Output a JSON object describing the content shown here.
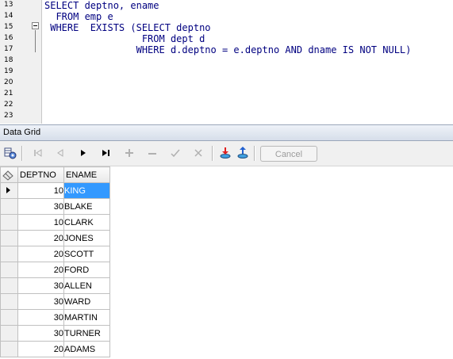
{
  "editor": {
    "lines": [
      {
        "num": "13",
        "text": "SELECT deptno, ename"
      },
      {
        "num": "14",
        "text": "  FROM emp e"
      },
      {
        "num": "15",
        "text": " WHERE  EXISTS (SELECT deptno"
      },
      {
        "num": "16",
        "text": "                 FROM dept d"
      },
      {
        "num": "17",
        "text": "                WHERE d.deptno = e.deptno AND dname IS NOT NULL)"
      },
      {
        "num": "18",
        "text": ""
      },
      {
        "num": "19",
        "text": ""
      },
      {
        "num": "20",
        "text": ""
      },
      {
        "num": "21",
        "text": ""
      },
      {
        "num": "22",
        "text": ""
      },
      {
        "num": "23",
        "text": ""
      }
    ]
  },
  "data_grid": {
    "title": "Data Grid",
    "toolbar": {
      "icons": [
        "grid-options-icon",
        "first-record-icon",
        "prior-record-icon",
        "next-record-icon",
        "last-record-icon",
        "insert-record-icon",
        "delete-record-icon",
        "post-edit-icon",
        "cancel-edit-icon",
        "export-icon",
        "import-icon"
      ],
      "cancel_label": "Cancel"
    },
    "columns": [
      "DEPTNO",
      "ENAME"
    ],
    "rows": [
      {
        "deptno": "10",
        "ename": "KING"
      },
      {
        "deptno": "30",
        "ename": "BLAKE"
      },
      {
        "deptno": "10",
        "ename": "CLARK"
      },
      {
        "deptno": "20",
        "ename": "JONES"
      },
      {
        "deptno": "20",
        "ename": "SCOTT"
      },
      {
        "deptno": "20",
        "ename": "FORD"
      },
      {
        "deptno": "30",
        "ename": "ALLEN"
      },
      {
        "deptno": "30",
        "ename": "WARD"
      },
      {
        "deptno": "30",
        "ename": "MARTIN"
      },
      {
        "deptno": "30",
        "ename": "TURNER"
      },
      {
        "deptno": "20",
        "ename": "ADAMS"
      }
    ],
    "colors": {
      "selection": "#3399ff",
      "grid_line": "#c0c0c0",
      "export_arrow": "#e02020",
      "import_arrow": "#2060d0"
    }
  }
}
